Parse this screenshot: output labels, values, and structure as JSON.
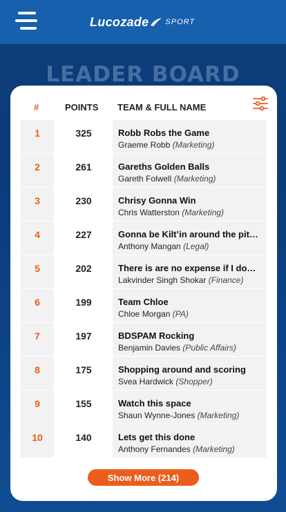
{
  "header": {
    "logo_main": "Lucozade",
    "logo_sub": "SPORT"
  },
  "page_title": "LEADER BOARD",
  "table": {
    "columns": {
      "rank": "#",
      "points": "POINTS",
      "team": "TEAM & FULL NAME"
    },
    "rows": [
      {
        "rank": "1",
        "points": "325",
        "team": "Robb Robs the Game",
        "name": "Graeme Robb",
        "dept": "(Marketing)"
      },
      {
        "rank": "2",
        "points": "261",
        "team": "Gareths Golden Balls",
        "name": "Gareth Folwell",
        "dept": "(Marketing)"
      },
      {
        "rank": "3",
        "points": "230",
        "team": "Chrisy Gonna Win",
        "name": "Chris Watterston",
        "dept": "(Marketing)"
      },
      {
        "rank": "4",
        "points": "227",
        "team": "Gonna be Kilt’in around the pit…",
        "name": "Anthony Mangan",
        "dept": "(Legal)"
      },
      {
        "rank": "5",
        "points": "202",
        "team": "There is are no expense if I do…",
        "name": "Lakvinder Singh Shokar",
        "dept": "(Finance)"
      },
      {
        "rank": "6",
        "points": "199",
        "team": "Team Chloe",
        "name": "Chloe Morgan",
        "dept": "(PA)"
      },
      {
        "rank": "7",
        "points": "197",
        "team": "BDSPAM Rocking",
        "name": "Benjamin Davies",
        "dept": "(Public Affairs)"
      },
      {
        "rank": "8",
        "points": "175",
        "team": "Shopping around and scoring",
        "name": "Svea Hardwick",
        "dept": "(Shopper)"
      },
      {
        "rank": "9",
        "points": "155",
        "team": "Watch this space",
        "name": "Shaun Wynne-Jones",
        "dept": "(Marketing)"
      },
      {
        "rank": "10",
        "points": "140",
        "team": "Lets get this done",
        "name": "Anthony Fernandes",
        "dept": "(Marketing)"
      }
    ]
  },
  "show_more_label": "Show More (214)",
  "icons": {
    "menu": "hamburger-menu-icon",
    "filter": "filter-sliders-icon"
  },
  "colors": {
    "accent": "#ea5d1c",
    "topbar": "#1660ad",
    "background": "#0c4487"
  }
}
